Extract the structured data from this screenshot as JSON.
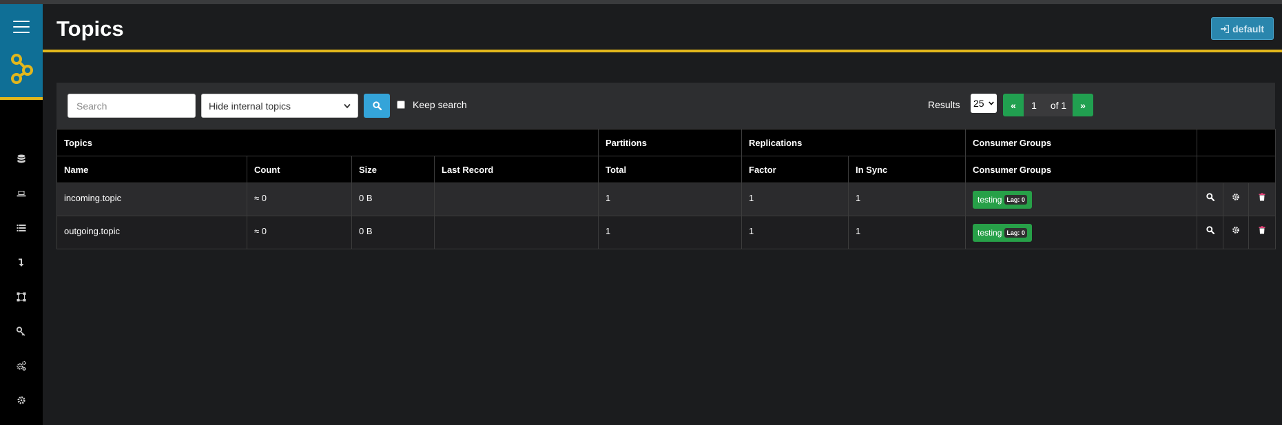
{
  "sidebar": {
    "menu_icon": "hamburger-icon",
    "logo_icon": "kafka-logo",
    "items": [
      {
        "name": "sidebar-item-nodes",
        "icon": "database-icon"
      },
      {
        "name": "sidebar-item-topics",
        "icon": "laptop-icon"
      },
      {
        "name": "sidebar-item-tail",
        "icon": "list-icon"
      },
      {
        "name": "sidebar-item-consumer-groups",
        "icon": "level-down-icon"
      },
      {
        "name": "sidebar-item-schema-registry",
        "icon": "tree-icon"
      },
      {
        "name": "sidebar-item-acls",
        "icon": "key-icon"
      },
      {
        "name": "sidebar-item-connects",
        "icon": "cogs-icon"
      },
      {
        "name": "sidebar-item-settings",
        "icon": "cog-icon"
      }
    ]
  },
  "header": {
    "title": "Topics",
    "cluster_label": "default",
    "cluster_icon": "sign-in-icon"
  },
  "toolbar": {
    "search_placeholder": "Search",
    "search_value": "",
    "topic_filter": "Hide internal topics",
    "keep_search_label": "Keep search",
    "keep_search_checked": false,
    "results_label": "Results",
    "results_per_page": "25",
    "pagination": {
      "prev": "«",
      "current": "1",
      "of": "of 1",
      "next": "»"
    }
  },
  "table": {
    "group_headers": [
      "Topics",
      "Partitions",
      "Replications",
      "Consumer Groups",
      ""
    ],
    "column_headers": [
      "Name",
      "Count",
      "Size",
      "Last Record",
      "Total",
      "Factor",
      "In Sync",
      "Consumer Groups"
    ],
    "rows": [
      {
        "name": "incoming.topic",
        "count": "≈ 0",
        "size": "0 B",
        "last_record": "",
        "total": "1",
        "factor": "1",
        "in_sync": "1",
        "consumer_group": "testing",
        "lag": "Lag: 0"
      },
      {
        "name": "outgoing.topic",
        "count": "≈ 0",
        "size": "0 B",
        "last_record": "",
        "total": "1",
        "factor": "1",
        "in_sync": "1",
        "consumer_group": "testing",
        "lag": "Lag: 0"
      }
    ]
  },
  "colors": {
    "accent": "#e2b71c",
    "sidebar_head": "#0f6f96",
    "success": "#27a048",
    "info": "#34a4d9"
  }
}
